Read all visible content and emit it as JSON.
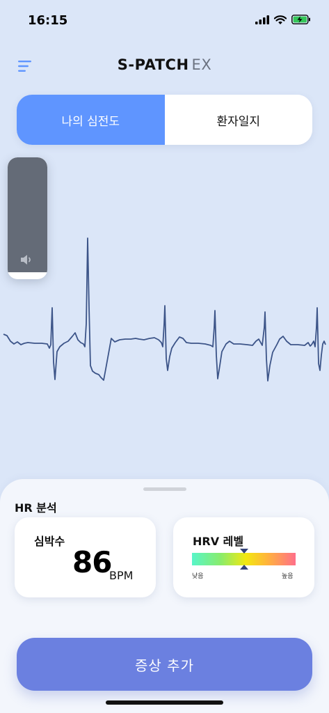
{
  "status_bar": {
    "time": "16:15"
  },
  "header": {
    "logo_main": "S-PATCH",
    "logo_suffix": "EX"
  },
  "tabs": [
    {
      "label": "나의 심전도",
      "active": true
    },
    {
      "label": "환자일지",
      "active": false
    }
  ],
  "hr_analysis": {
    "title": "HR 분석",
    "heart_rate": {
      "label": "심박수",
      "value": "86",
      "unit": "BPM"
    },
    "hrv": {
      "label": "HRV 레벨",
      "low_label": "낮음",
      "high_label": "높음",
      "level": 0.5
    }
  },
  "actions": {
    "add_symptom_label": "증상 추가"
  },
  "colors": {
    "accent": "#5f95ff",
    "button": "#6b80e0",
    "ecg_line": "#3c5488",
    "volume": "#646b77"
  },
  "icons": [
    "menu-icon",
    "signal-icon",
    "wifi-icon",
    "battery-charging-icon",
    "speaker-icon"
  ]
}
